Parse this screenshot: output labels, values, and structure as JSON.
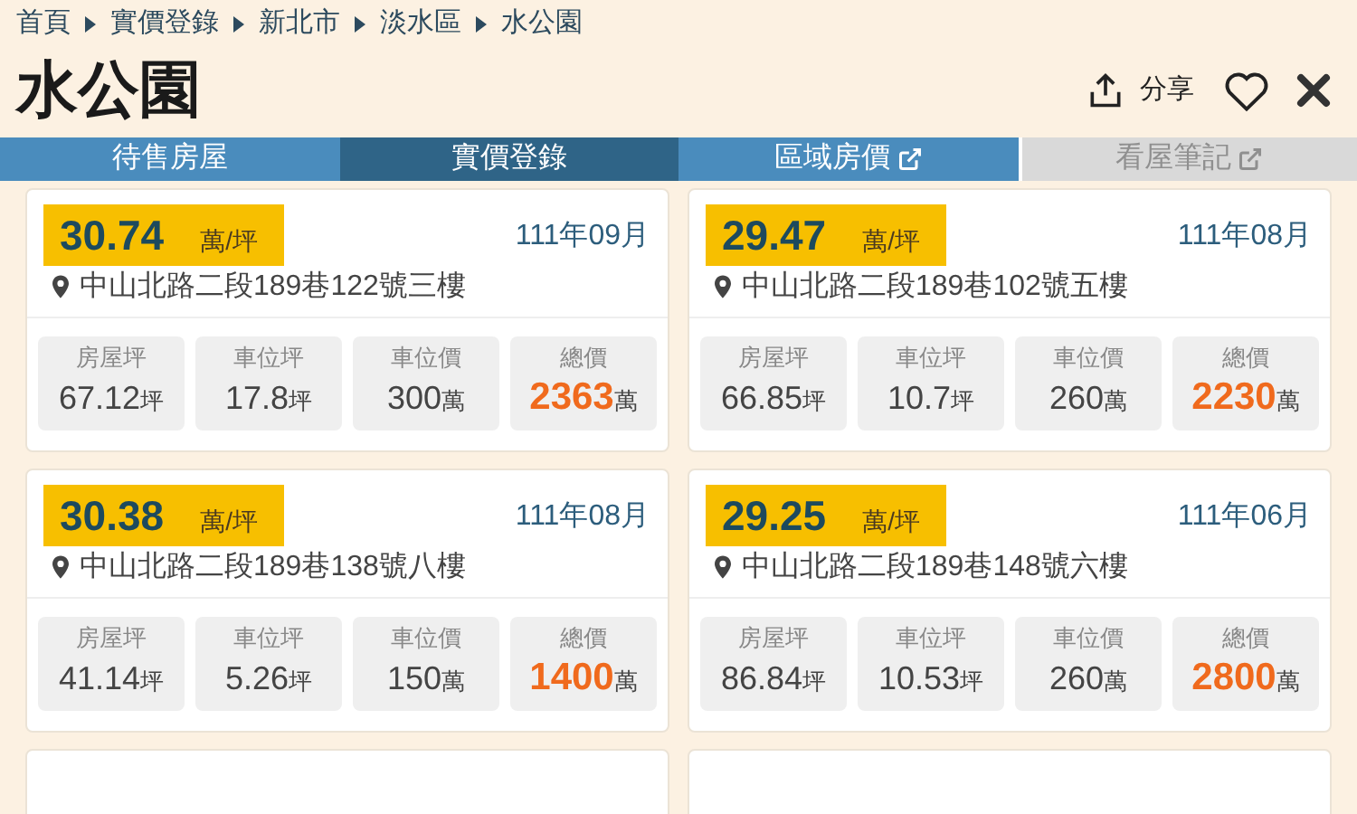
{
  "breadcrumb": [
    "首頁",
    "實價登錄",
    "新北市",
    "淡水區",
    "水公園"
  ],
  "title": "水公園",
  "actions": {
    "share": "分享"
  },
  "tabs": [
    {
      "label": "待售房屋",
      "selected": false,
      "disabled": false,
      "external": false
    },
    {
      "label": "實價登錄",
      "selected": true,
      "disabled": false,
      "external": false
    },
    {
      "label": "區域房價",
      "selected": false,
      "disabled": false,
      "external": true
    },
    {
      "label": "看屋筆記",
      "selected": false,
      "disabled": true,
      "external": true
    }
  ],
  "records": [
    {
      "price": "30.74",
      "price_unit": "萬/坪",
      "date": "111年09月",
      "address": "中山北路二段189巷122號三樓",
      "stats": [
        {
          "kind": "plain",
          "label": "房屋坪",
          "value": "67.12",
          "unit": "坪"
        },
        {
          "kind": "plain",
          "label": "車位坪",
          "value": "17.8",
          "unit": "坪"
        },
        {
          "kind": "plain",
          "label": "車位價",
          "value": "300",
          "unit": "萬"
        },
        {
          "kind": "total",
          "label": "總價",
          "value": "2363",
          "unit": "萬"
        }
      ]
    },
    {
      "price": "29.47",
      "price_unit": "萬/坪",
      "date": "111年08月",
      "address": "中山北路二段189巷102號五樓",
      "stats": [
        {
          "kind": "plain",
          "label": "房屋坪",
          "value": "66.85",
          "unit": "坪"
        },
        {
          "kind": "plain",
          "label": "車位坪",
          "value": "10.7",
          "unit": "坪"
        },
        {
          "kind": "plain",
          "label": "車位價",
          "value": "260",
          "unit": "萬"
        },
        {
          "kind": "total",
          "label": "總價",
          "value": "2230",
          "unit": "萬"
        }
      ]
    },
    {
      "price": "30.38",
      "price_unit": "萬/坪",
      "date": "111年08月",
      "address": "中山北路二段189巷138號八樓",
      "stats": [
        {
          "kind": "plain",
          "label": "房屋坪",
          "value": "41.14",
          "unit": "坪"
        },
        {
          "kind": "plain",
          "label": "車位坪",
          "value": "5.26",
          "unit": "坪"
        },
        {
          "kind": "plain",
          "label": "車位價",
          "value": "150",
          "unit": "萬"
        },
        {
          "kind": "total",
          "label": "總價",
          "value": "1400",
          "unit": "萬"
        }
      ]
    },
    {
      "price": "29.25",
      "price_unit": "萬/坪",
      "date": "111年06月",
      "address": "中山北路二段189巷148號六樓",
      "stats": [
        {
          "kind": "plain",
          "label": "房屋坪",
          "value": "86.84",
          "unit": "坪"
        },
        {
          "kind": "plain",
          "label": "車位坪",
          "value": "10.53",
          "unit": "坪"
        },
        {
          "kind": "plain",
          "label": "車位價",
          "value": "260",
          "unit": "萬"
        },
        {
          "kind": "total",
          "label": "總價",
          "value": "2800",
          "unit": "萬"
        }
      ]
    }
  ]
}
